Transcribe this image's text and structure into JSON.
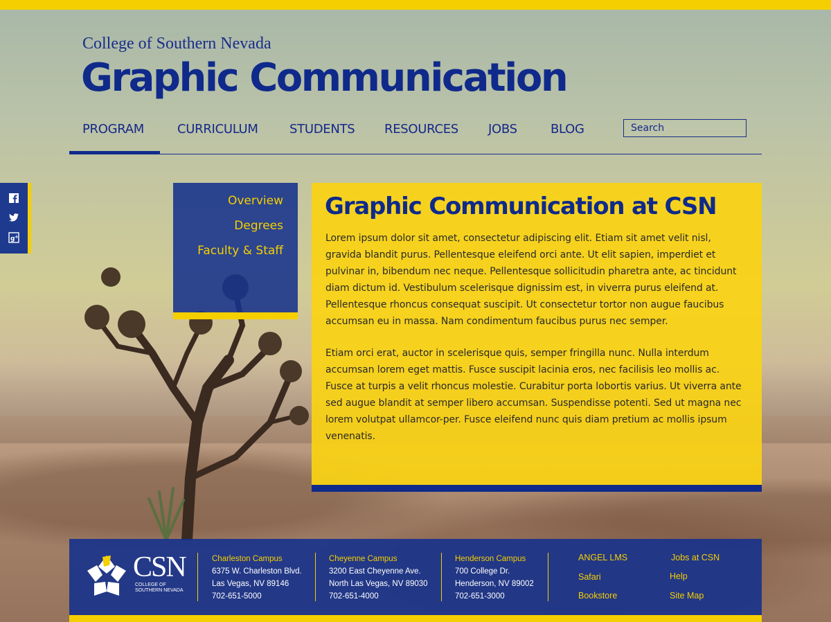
{
  "header": {
    "college_name": "College of Southern Nevada",
    "site_title": "Graphic Communication"
  },
  "nav": {
    "items": [
      {
        "label": "PROGRAM",
        "active": true
      },
      {
        "label": "CURRICULUM"
      },
      {
        "label": "STUDENTS"
      },
      {
        "label": "RESOURCES"
      },
      {
        "label": "JOBS"
      },
      {
        "label": "BLOG"
      }
    ],
    "search_placeholder": "Search"
  },
  "social": {
    "icons": [
      "facebook-icon",
      "twitter-icon",
      "google-plus-icon"
    ]
  },
  "subnav": {
    "items": [
      "Overview",
      "Degrees",
      "Faculty & Staff"
    ]
  },
  "content": {
    "heading": "Graphic Communication at CSN",
    "paragraphs": [
      "Lorem ipsum dolor sit amet, consectetur adipiscing elit. Etiam sit amet velit nisl, gravida blandit purus. Pellentesque eleifend orci ante. Ut elit sapien, imperdiet et pulvinar in, bibendum nec neque. Pellentesque sollicitudin pharetra ante, ac tincidunt diam dictum id. Vestibulum scelerisque dignissim est, in viverra purus eleifend at. Pellentesque rhoncus consequat suscipit. Ut consectetur tortor non augue faucibus accumsan eu in massa. Nam condimentum faucibus purus nec semper.",
      "Etiam orci erat, auctor in scelerisque quis, semper fringilla nunc. Nulla interdum accumsan lorem eget mattis. Fusce suscipit lacinia eros, nec facilisis leo mollis ac. Fusce at turpis a velit rhoncus molestie. Curabitur porta lobortis varius. Ut viverra ante sed augue blandit at semper libero accumsan. Suspendisse potenti. Sed ut magna nec lorem volutpat ullamcor-per. Fusce eleifend nunc quis diam pretium ac mollis ipsum venenatis."
    ]
  },
  "footer": {
    "logo_text": "CSN",
    "logo_sub": "COLLEGE OF SOUTHERN NEVADA",
    "campuses": [
      {
        "name": "Charleston Campus",
        "address": "6375 W. Charleston Blvd.",
        "city": "Las Vegas, NV 89146",
        "phone": "702-651-5000"
      },
      {
        "name": "Cheyenne Campus",
        "address": "3200 East Cheyenne Ave.",
        "city": "North Las Vegas, NV 89030",
        "phone": "702-651-4000"
      },
      {
        "name": "Henderson Campus",
        "address": "700 College Dr.",
        "city": "Henderson, NV 89002",
        "phone": "702-651-3000"
      }
    ],
    "links_col1": [
      "ANGEL LMS",
      "Safari",
      "Bookstore"
    ],
    "links_col2": [
      "Jobs at CSN",
      "Help",
      "Site Map"
    ]
  },
  "colors": {
    "accent_yellow": "#f6cf00",
    "brand_blue": "#0f2a8a"
  }
}
